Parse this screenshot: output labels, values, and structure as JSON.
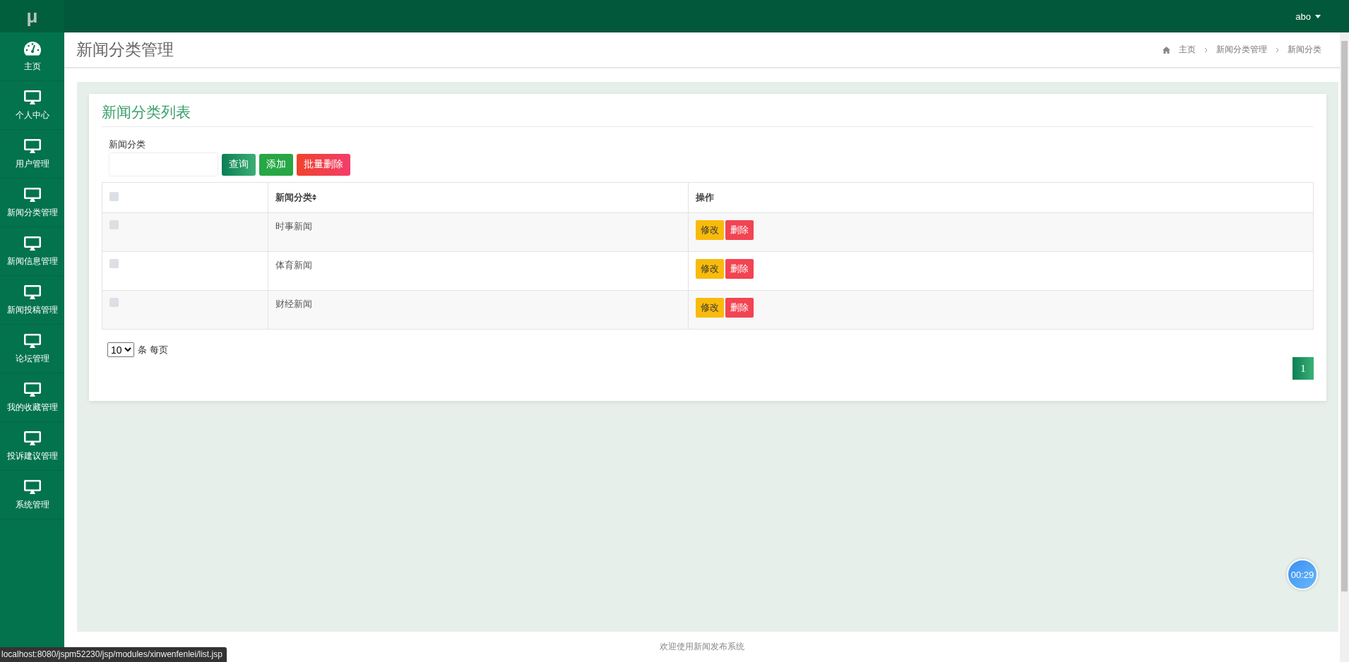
{
  "topbar": {
    "logo": "μ",
    "user": "abo"
  },
  "sidebar": {
    "items": [
      {
        "label": "主页",
        "kind": "dashboard",
        "selected": false
      },
      {
        "label": "个人中心",
        "kind": "monitor",
        "selected": false
      },
      {
        "label": "用户管理",
        "kind": "monitor",
        "selected": false
      },
      {
        "label": "新闻分类管理",
        "kind": "monitor",
        "selected": false
      },
      {
        "label": "新闻信息管理",
        "kind": "monitor",
        "selected": false
      },
      {
        "label": "新闻投稿管理",
        "kind": "monitor",
        "selected": false
      },
      {
        "label": "论坛管理",
        "kind": "monitor",
        "selected": false
      },
      {
        "label": "我的收藏管理",
        "kind": "monitor",
        "selected": false
      },
      {
        "label": "投诉建议管理",
        "kind": "monitor",
        "selected": false
      },
      {
        "label": "系统管理",
        "kind": "monitor",
        "selected": false
      }
    ]
  },
  "header": {
    "title": "新闻分类管理",
    "breadcrumb": [
      "主页",
      "新闻分类管理",
      "新闻分类"
    ]
  },
  "card": {
    "title": "新闻分类列表",
    "search": {
      "label": "新闻分类",
      "buttons": [
        {
          "label": "查询",
          "kind": "query"
        },
        {
          "label": "添加",
          "kind": "add"
        },
        {
          "label": "批量删除",
          "kind": "delete"
        }
      ]
    },
    "table": {
      "header_checked": false,
      "columns": [
        "新闻分类",
        "操作"
      ],
      "rows": [
        {
          "checked": false,
          "category": "时事新闻",
          "actions": [
            "修改",
            "删除"
          ]
        },
        {
          "checked": false,
          "category": "体育新闻",
          "actions": [
            "修改",
            "删除"
          ]
        },
        {
          "checked": false,
          "category": "财经新闻",
          "actions": [
            "修改",
            "删除"
          ]
        }
      ]
    },
    "page_size": {
      "value": "10",
      "label": "条 每页"
    },
    "pages": [
      {
        "label": "1",
        "selected": true
      }
    ]
  },
  "timer": "00:29",
  "footer": "欢迎使用新闻发布系统",
  "status_bar": "localhost:8080/jspm52230/jsp/modules/xinwenfenlei/list.jsp"
}
